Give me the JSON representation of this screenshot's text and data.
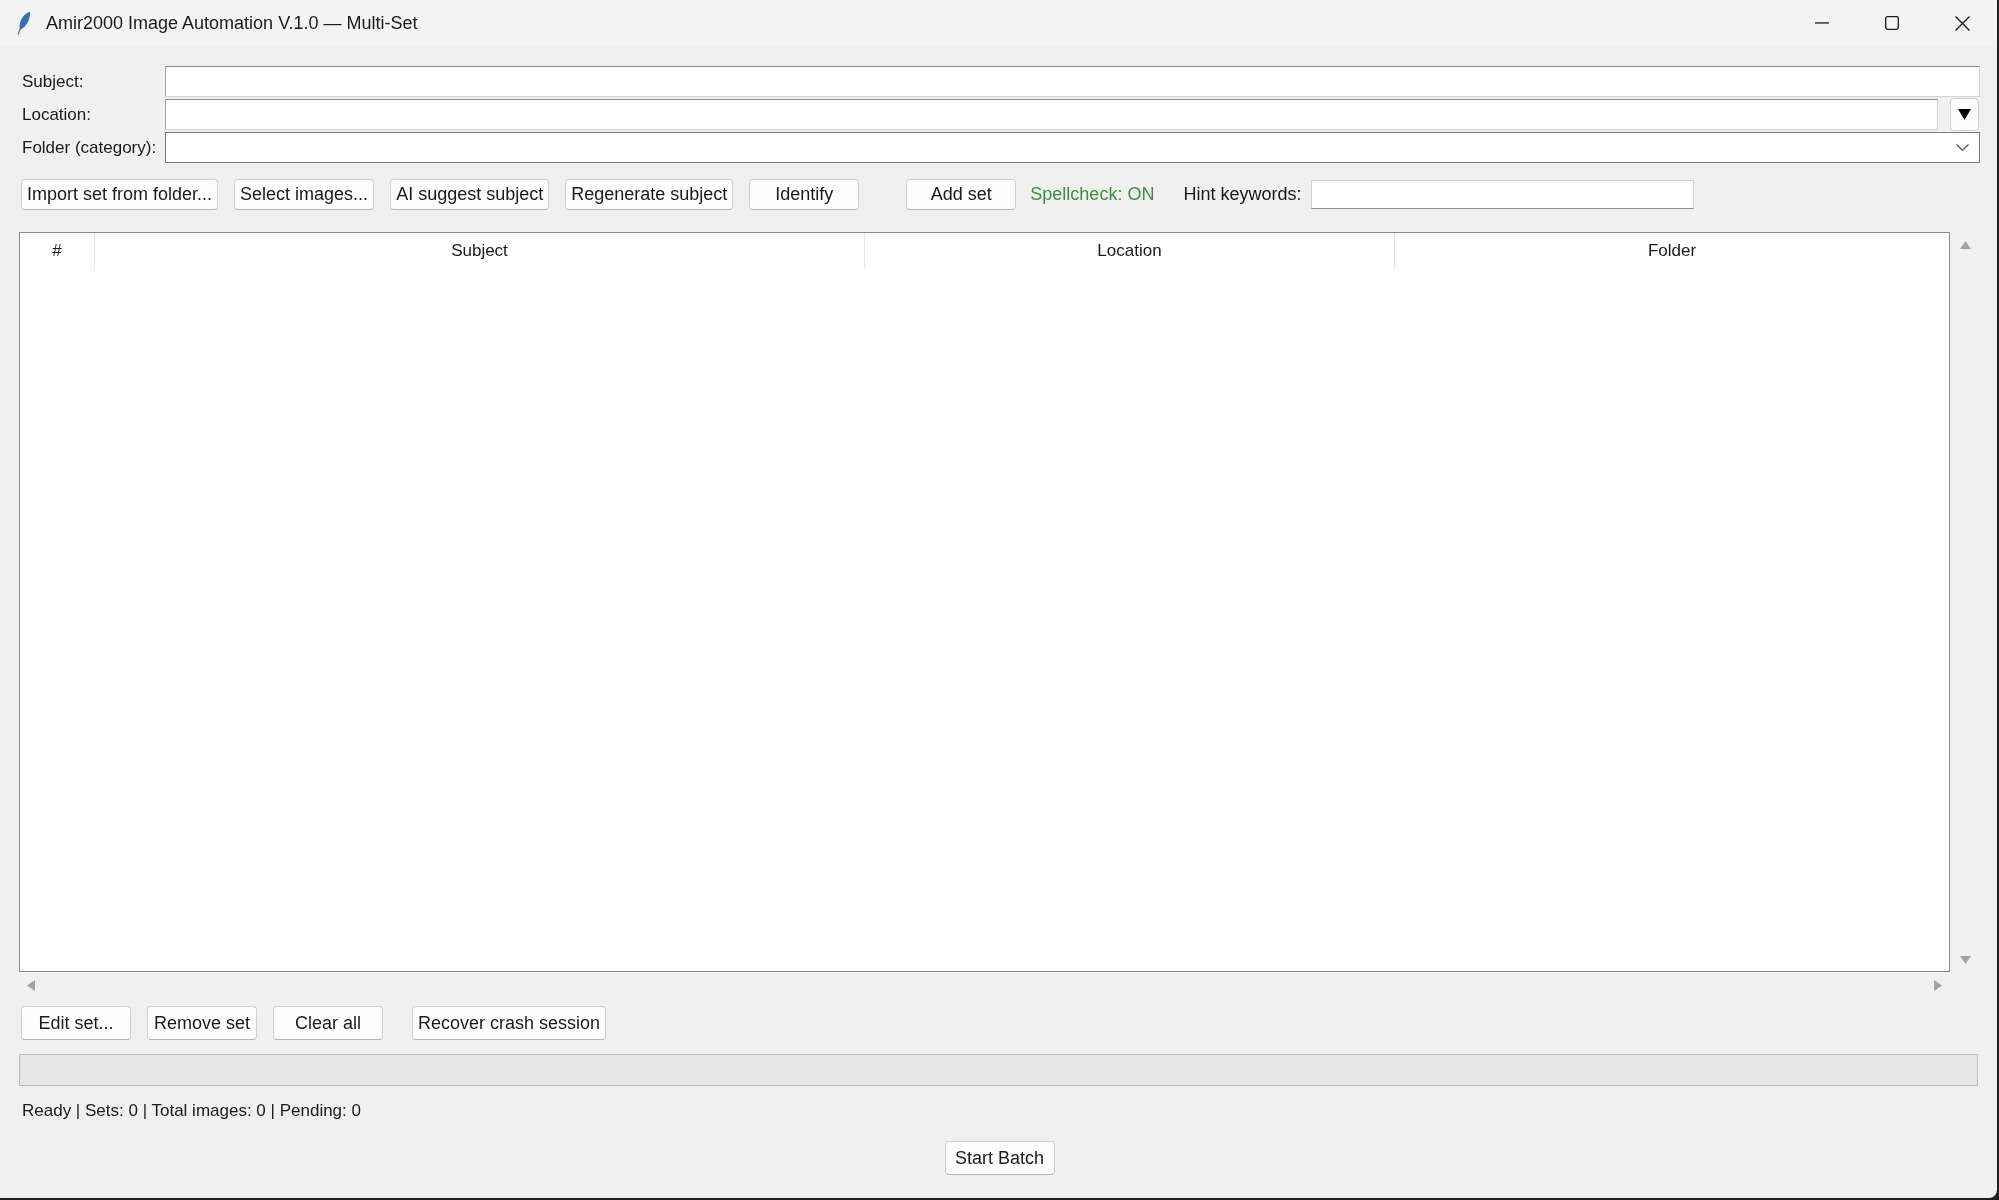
{
  "window": {
    "title": "Amir2000 Image Automation V.1.0 — Multi-Set"
  },
  "form": {
    "fields": [
      {
        "label": "Subject:",
        "kind": "entry"
      },
      {
        "label": "Location:",
        "kind": "entry_dropdown"
      },
      {
        "label": "Folder (category):",
        "kind": "combobox"
      }
    ]
  },
  "toolbar": {
    "buttons": [
      "Import set from folder...",
      "Select images...",
      "AI suggest subject",
      "Regenerate subject",
      "Identify"
    ],
    "add_set_button": "Add set",
    "spellcheck": {
      "label": "Spellcheck: ON",
      "on": true
    },
    "hint": {
      "label": "Hint keywords:"
    }
  },
  "table": {
    "columns": [
      "#",
      "Subject",
      "Location",
      "Folder"
    ]
  },
  "actions": {
    "buttons": [
      "Edit set...",
      "Remove set",
      "Clear all"
    ],
    "recover_button": "Recover crash session"
  },
  "progress": {
    "level": 0
  },
  "status_bar": "Ready | Sets: 0 | Total images: 0 | Pending: 0",
  "start_button": "Start Batch"
}
